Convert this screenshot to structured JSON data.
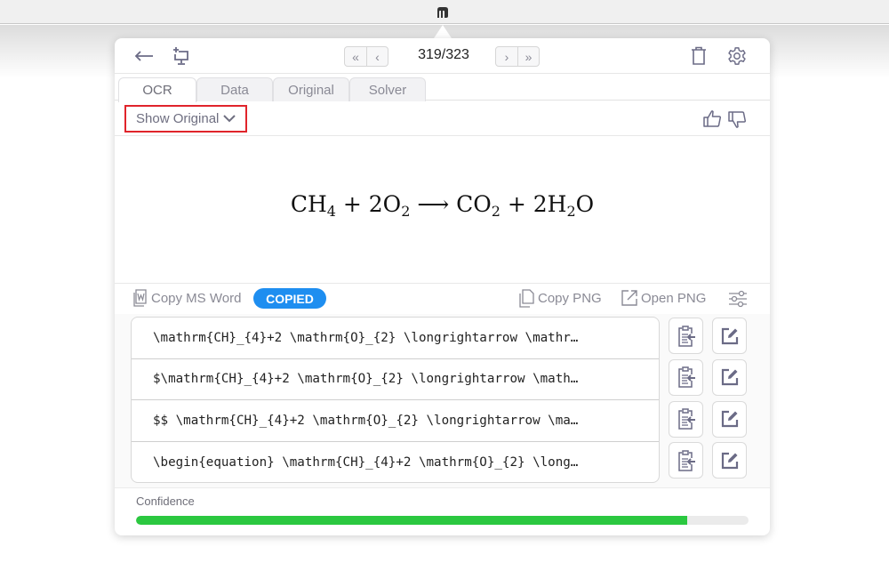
{
  "toolbar": {
    "page_counter": "319/323",
    "icons": {
      "back": "arrow-left-icon",
      "capture": "screen-capture-icon",
      "first": "double-chevron-left-icon",
      "prev": "chevron-left-icon",
      "next": "chevron-right-icon",
      "last": "double-chevron-right-icon",
      "delete": "trash-icon",
      "settings": "gear-icon"
    }
  },
  "tabs": [
    {
      "label": "OCR",
      "active": true
    },
    {
      "label": "Data",
      "active": false
    },
    {
      "label": "Original",
      "active": false
    },
    {
      "label": "Solver",
      "active": false
    }
  ],
  "show_original": {
    "label": "Show Original"
  },
  "equation": {
    "latex": "\\mathrm{CH}_{4}+2 \\mathrm{O}_{2} \\longrightarrow \\mathrm{CO}_{2}+2 \\mathrm{H}_{2} \\mathrm{O}",
    "parts": [
      "CH",
      "4",
      " + 2O",
      "2",
      " ⟶ CO",
      "2",
      " + 2H",
      "2",
      "O"
    ]
  },
  "actions": {
    "copy_ms_word": "Copy MS Word",
    "copied_badge": "COPIED",
    "copy_png": "Copy PNG",
    "open_png": "Open PNG"
  },
  "formats": [
    {
      "text": "\\mathrm{CH}_{4}+2 \\mathrm{O}_{2} \\longrightarrow \\mathr…"
    },
    {
      "text": "$\\mathrm{CH}_{4}+2 \\mathrm{O}_{2} \\longrightarrow \\math…"
    },
    {
      "text": "$$ \\mathrm{CH}_{4}+2 \\mathrm{O}_{2} \\longrightarrow \\ma…"
    },
    {
      "text": "\\begin{equation} \\mathrm{CH}_{4}+2 \\mathrm{O}_{2} \\long…"
    }
  ],
  "confidence": {
    "label": "Confidence",
    "value": 0.9
  },
  "colors": {
    "accent": "#1e8ef0",
    "confidence_fill": "#2bc840",
    "highlight_border": "#e0242b",
    "icon": "#6b6b86"
  }
}
